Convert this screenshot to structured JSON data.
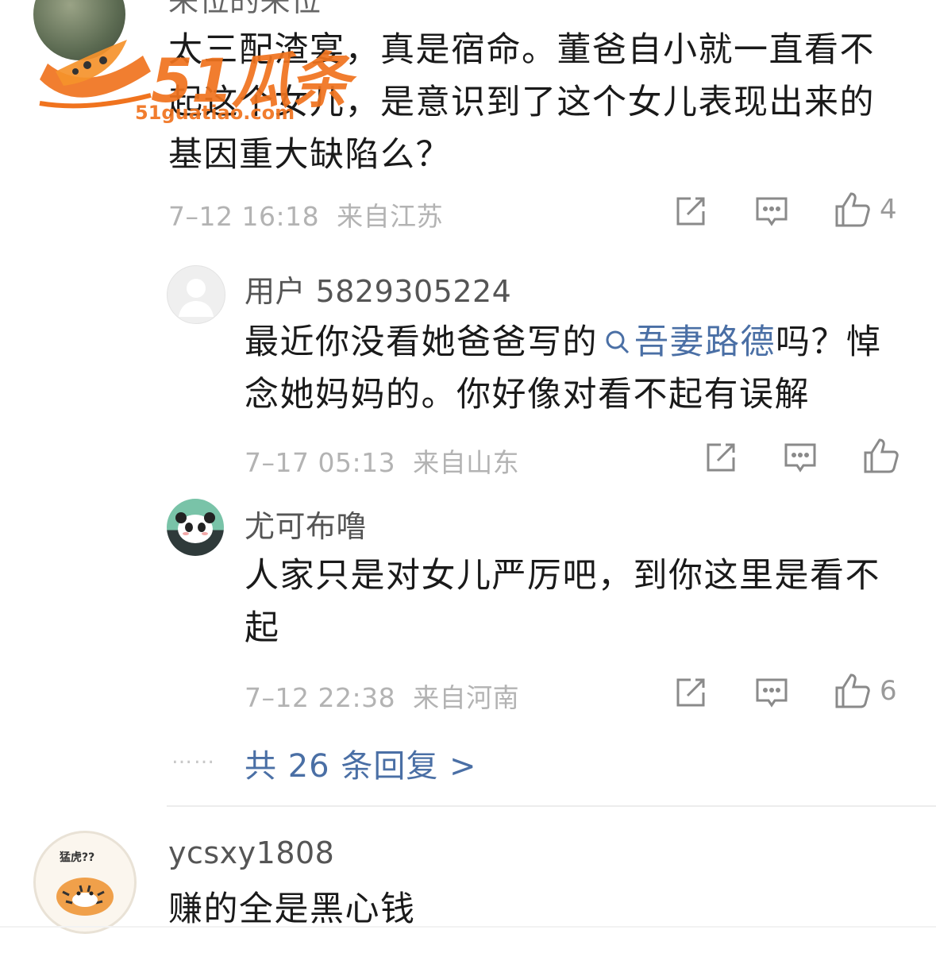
{
  "comments": [
    {
      "username": "来位的来位",
      "text_lines": [
        "太三配渣宴，真是宿命。董爸自小就一直看不",
        "起这个女儿，是意识到了这个女儿表现出来的",
        "基因重大缺陷么？"
      ],
      "time": "7–12 16:18",
      "location": "来自江苏",
      "like_count": "4"
    }
  ],
  "replies": [
    {
      "username": "用户 5829305224",
      "text_pre": "最近你没看她爸爸写的",
      "topic": "吾妻路德",
      "text_post": "吗？悼",
      "text_line2": "念她妈妈的。你好像对看不起有误解",
      "time": "7–17 05:13",
      "location": "来自山东",
      "like_count": ""
    },
    {
      "username": "尤可布噜",
      "text_lines": [
        "人家只是对女儿严厉吧，到你这里是看不",
        "起"
      ],
      "time": "7–12 22:38",
      "location": "来自河南",
      "like_count": "6"
    }
  ],
  "more_replies_label": "共 26 条回复 >",
  "more_dots": "……",
  "next_comment": {
    "username": "ycsxy1808",
    "text": "赚的全是黑心钱",
    "avatar_caption": "猛虎??"
  },
  "watermark": {
    "brand": "51瓜条",
    "url": "51guatiao.com"
  },
  "icons": [
    "share-icon",
    "comment-icon",
    "like-icon"
  ],
  "colors": {
    "link": "#4a6fa5",
    "meta": "#b3b3b3",
    "watermark": "#f0731e"
  }
}
